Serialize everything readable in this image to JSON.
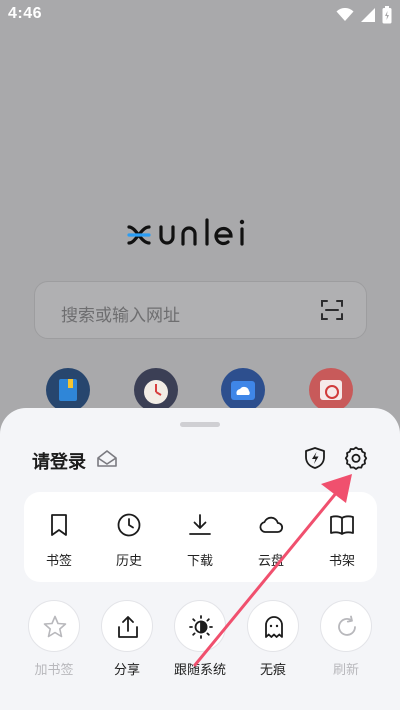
{
  "status": {
    "time": "4:46"
  },
  "search": {
    "placeholder": "搜索或输入网址"
  },
  "sheet": {
    "login_label": "请登录",
    "card_items": [
      {
        "label": "书签",
        "icon": "bookmark-icon"
      },
      {
        "label": "历史",
        "icon": "clock-icon"
      },
      {
        "label": "下载",
        "icon": "download-icon"
      },
      {
        "label": "云盘",
        "icon": "cloud-icon"
      },
      {
        "label": "书架",
        "icon": "book-icon"
      }
    ],
    "actions": [
      {
        "label": "加书签",
        "icon": "star-icon",
        "enabled": false
      },
      {
        "label": "分享",
        "icon": "share-icon",
        "enabled": true
      },
      {
        "label": "跟随系统",
        "icon": "theme-icon",
        "enabled": true
      },
      {
        "label": "无痕",
        "icon": "ghost-icon",
        "enabled": true
      },
      {
        "label": "刷新",
        "icon": "refresh-icon",
        "enabled": false
      }
    ]
  },
  "colors": {
    "annotation_arrow": "#f0506e",
    "sheet_bg": "#f4f5f8",
    "dim_bg": "#a9a9ab"
  }
}
